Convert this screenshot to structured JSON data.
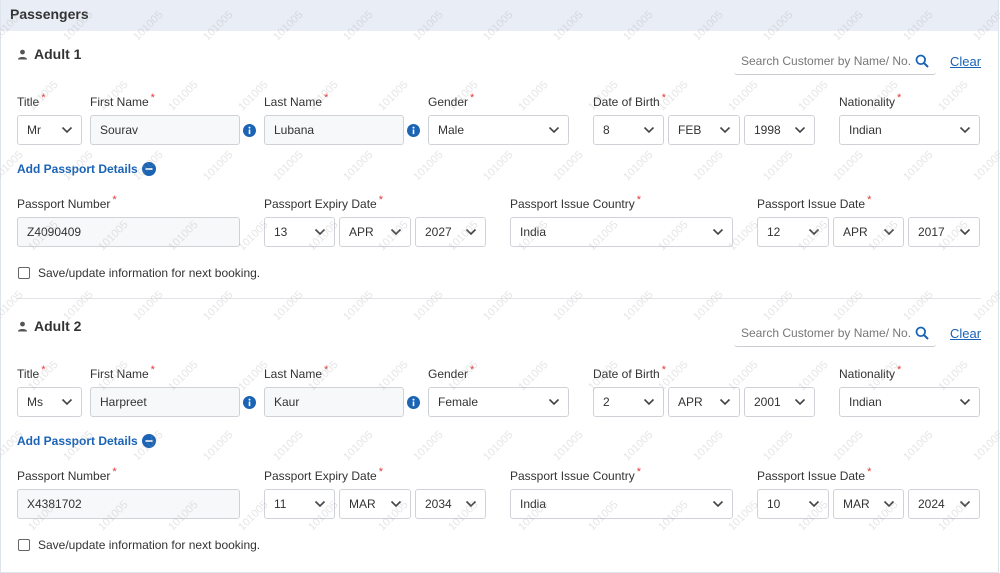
{
  "header": {
    "title": "Passengers"
  },
  "watermark": {
    "text": "101005"
  },
  "passengers": [
    {
      "title": "Adult 1",
      "search_placeholder": "Search Customer by Name/ No.",
      "clear_label": "Clear",
      "labels": {
        "title": "Title",
        "first_name": "First Name",
        "last_name": "Last Name",
        "gender": "Gender",
        "dob": "Date of Birth",
        "nationality": "Nationality",
        "passport_number": "Passport Number",
        "passport_expiry": "Passport Expiry Date",
        "issue_country": "Passport Issue Country",
        "issue_date": "Passport Issue Date"
      },
      "required_mark": "*",
      "values": {
        "title": "Mr",
        "first_name": "Sourav",
        "last_name": "Lubana",
        "gender": "Male",
        "dob_day": "8",
        "dob_month": "FEB",
        "dob_year": "1998",
        "nationality": "Indian",
        "passport_number": "Z4090409",
        "expiry_day": "13",
        "expiry_month": "APR",
        "expiry_year": "2027",
        "issue_country": "India",
        "issue_day": "12",
        "issue_month": "APR",
        "issue_year": "2017"
      },
      "add_passport_label": "Add Passport Details",
      "save_label": "Save/update information for next booking."
    },
    {
      "title": "Adult 2",
      "search_placeholder": "Search Customer by Name/ No.",
      "clear_label": "Clear",
      "labels": {
        "title": "Title",
        "first_name": "First Name",
        "last_name": "Last Name",
        "gender": "Gender",
        "dob": "Date of Birth",
        "nationality": "Nationality",
        "passport_number": "Passport Number",
        "passport_expiry": "Passport Expiry Date",
        "issue_country": "Passport Issue Country",
        "issue_date": "Passport Issue Date"
      },
      "required_mark": "*",
      "values": {
        "title": "Ms",
        "first_name": "Harpreet",
        "last_name": "Kaur",
        "gender": "Female",
        "dob_day": "2",
        "dob_month": "APR",
        "dob_year": "2001",
        "nationality": "Indian",
        "passport_number": "X4381702",
        "expiry_day": "11",
        "expiry_month": "MAR",
        "expiry_year": "2034",
        "issue_country": "India",
        "issue_day": "10",
        "issue_month": "MAR",
        "issue_year": "2024"
      },
      "add_passport_label": "Add Passport Details",
      "save_label": "Save/update information for next booking."
    }
  ],
  "colors": {
    "accent": "#1a63b5",
    "required": "#e53935",
    "header_bg": "#e9eef6"
  },
  "icons": {
    "person": "person-icon",
    "info": "info-icon",
    "search": "search-icon",
    "collapse": "minus-circle-icon",
    "dropdown": "chevron-down-icon"
  }
}
